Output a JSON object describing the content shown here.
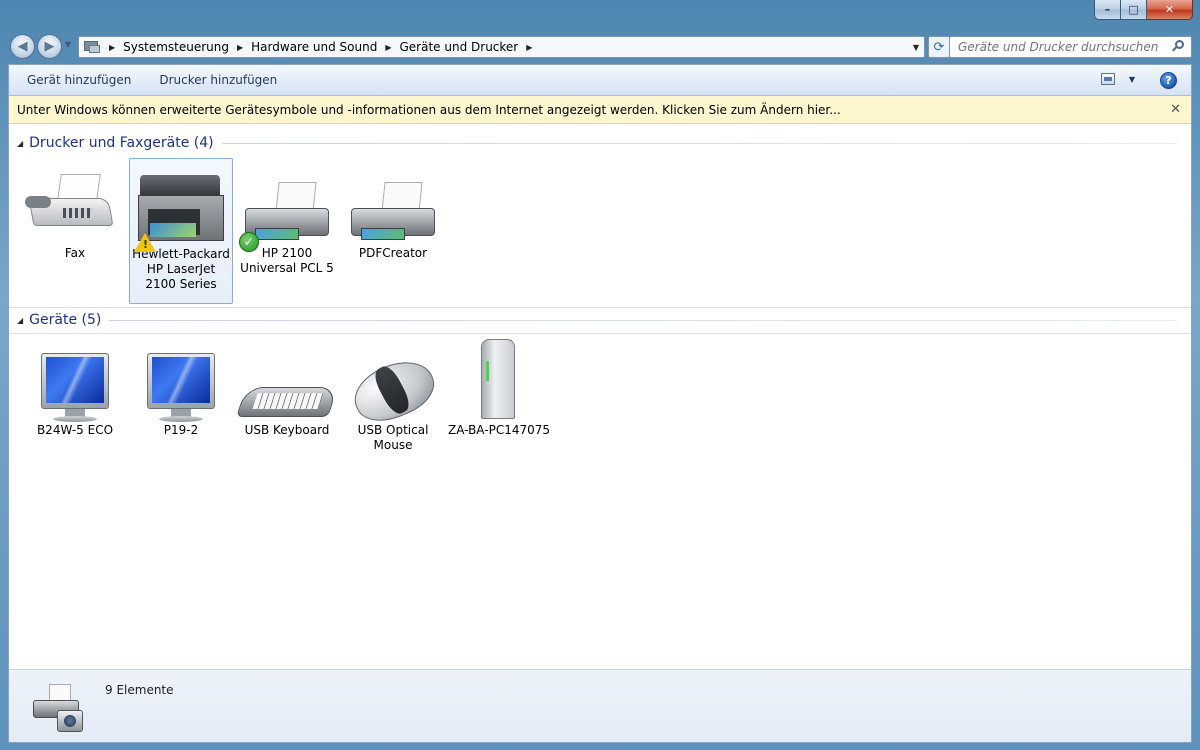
{
  "window": {
    "minimize_glyph": "–",
    "maximize_glyph": "□",
    "close_glyph": "✕"
  },
  "nav": {
    "back_glyph": "◀",
    "forward_glyph": "▶"
  },
  "address": {
    "breadcrumbs": [
      "Systemsteuerung",
      "Hardware und Sound",
      "Geräte und Drucker"
    ],
    "separator_glyph": "▶"
  },
  "search": {
    "placeholder": "Geräte und Drucker durchsuchen"
  },
  "toolbar": {
    "add_device": "Gerät hinzufügen",
    "add_printer": "Drucker hinzufügen",
    "help_glyph": "?"
  },
  "infobar": {
    "text": "Unter Windows können erweiterte Gerätesymbole und -informationen aus dem Internet angezeigt werden. Klicken Sie zum Ändern hier...",
    "close_glyph": "✕"
  },
  "groups": [
    {
      "title": "Drucker und Faxgeräte (4)",
      "items": [
        {
          "label": "Fax",
          "icon": "fax-icon"
        },
        {
          "label": "Hewlett-Packard HP LaserJet 2100 Series",
          "icon": "multifunction-printer-icon",
          "badge": "warning",
          "selected": true
        },
        {
          "label": "HP 2100 Universal PCL 5",
          "icon": "printer-icon",
          "badge": "default-check"
        },
        {
          "label": "PDFCreator",
          "icon": "printer-icon"
        }
      ]
    },
    {
      "title": "Geräte (5)",
      "items": [
        {
          "label": "B24W-5 ECO",
          "icon": "monitor-icon"
        },
        {
          "label": "P19-2",
          "icon": "monitor-icon"
        },
        {
          "label": "USB Keyboard",
          "icon": "keyboard-icon"
        },
        {
          "label": "USB Optical Mouse",
          "icon": "mouse-icon"
        },
        {
          "label": "ZA-BA-PC147075",
          "icon": "computer-tower-icon"
        }
      ]
    }
  ],
  "details": {
    "count_text": "9 Elemente",
    "icon": "devices-and-printers-icon"
  },
  "colors": {
    "group_title": "#1e3287",
    "infobar_bg": "#fdf6cf",
    "selection_border": "#84acdd"
  }
}
